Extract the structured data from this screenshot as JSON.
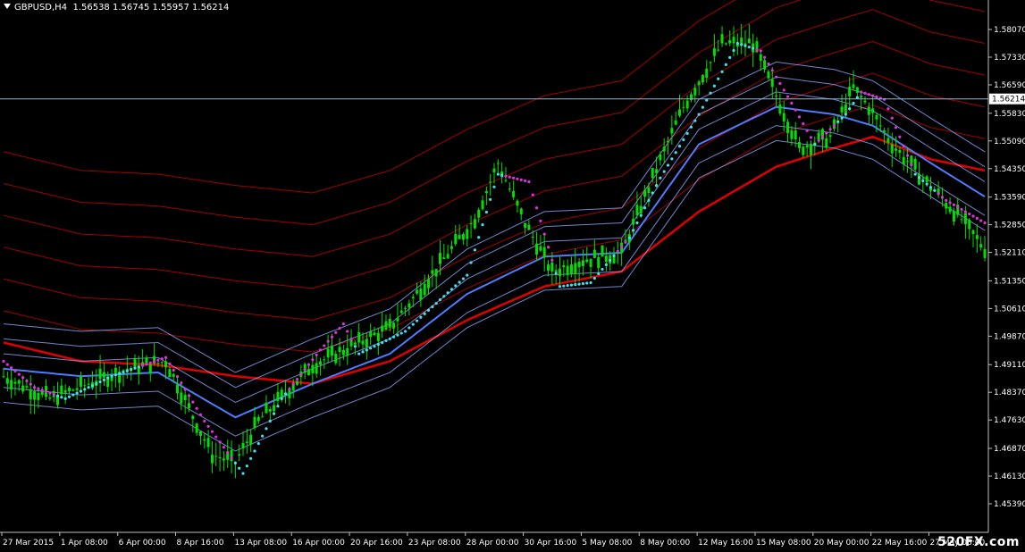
{
  "header": {
    "symbol": "GBPUSD,H4",
    "quote": "1.56538 1.56745 1.55957 1.56214"
  },
  "watermark": "520FX.com",
  "colors": {
    "background": "#000000",
    "axis": "#c0c0c0",
    "bull_candle": "#00e000",
    "fast_ma": "#4f7cff",
    "fast_ribbon": "#8fa6ff",
    "slow_ma": "#e00000",
    "slow_ribbon": "#b30000",
    "trail_up": "#40e0f0",
    "trail_down": "#e030e0",
    "price_line": "#8cb4d2"
  },
  "chart_data": {
    "type": "line",
    "title": "GBPUSD,H4",
    "xlabel": "",
    "ylabel": "",
    "ylim": [
      1.4539,
      1.5807
    ],
    "current_price": "1.56214",
    "yticks": [
      "1.58070",
      "1.57330",
      "1.56590",
      "1.55830",
      "1.55090",
      "1.54350",
      "1.53590",
      "1.52850",
      "1.52110",
      "1.51350",
      "1.50610",
      "1.49870",
      "1.49110",
      "1.48370",
      "1.47630",
      "1.46870",
      "1.46130",
      "1.45390"
    ],
    "ytick_values": [
      1.5807,
      1.5733,
      1.5659,
      1.5583,
      1.5509,
      1.5435,
      1.5359,
      1.5285,
      1.5211,
      1.5135,
      1.5061,
      1.4987,
      1.4911,
      1.4837,
      1.4763,
      1.4687,
      1.4613,
      1.4539
    ],
    "xticks": [
      "27 Mar 2015",
      "1 Apr 08:00",
      "6 Apr 00:00",
      "8 Apr 16:00",
      "13 Apr 08:00",
      "16 Apr 00:00",
      "20 Apr 16:00",
      "23 Apr 08:00",
      "28 Apr 00:00",
      "30 Apr 16:00",
      "5 May 08:00",
      "8 May 00:00",
      "12 May 16:00",
      "15 May 08:00",
      "20 May 00:00",
      "22 May 16:00",
      "27 May 08:00"
    ],
    "xtick_positions": [
      0,
      15,
      30,
      45,
      60,
      75,
      90,
      105,
      120,
      135,
      150,
      165,
      180,
      195,
      210,
      225,
      240
    ],
    "bars": 255,
    "price_path": [
      [
        0,
        1.488
      ],
      [
        12,
        1.482
      ],
      [
        32,
        1.49
      ],
      [
        42,
        1.492
      ],
      [
        54,
        1.467
      ],
      [
        60,
        1.465
      ],
      [
        66,
        1.476
      ],
      [
        80,
        1.491
      ],
      [
        100,
        1.501
      ],
      [
        110,
        1.514
      ],
      [
        122,
        1.53
      ],
      [
        128,
        1.545
      ],
      [
        135,
        1.529
      ],
      [
        142,
        1.516
      ],
      [
        150,
        1.519
      ],
      [
        160,
        1.521
      ],
      [
        168,
        1.541
      ],
      [
        176,
        1.56
      ],
      [
        186,
        1.577
      ],
      [
        194,
        1.577
      ],
      [
        200,
        1.563
      ],
      [
        206,
        1.549
      ],
      [
        214,
        1.552
      ],
      [
        220,
        1.565
      ],
      [
        224,
        1.56
      ],
      [
        230,
        1.55
      ],
      [
        238,
        1.541
      ],
      [
        248,
        1.53
      ],
      [
        254,
        1.522
      ]
    ],
    "series": [
      {
        "name": "",
        "values": [
          [
            0,
            1.49
          ],
          [
            20,
            1.488
          ],
          [
            40,
            1.489
          ],
          [
            60,
            1.477
          ],
          [
            80,
            1.486
          ],
          [
            100,
            1.494
          ],
          [
            120,
            1.51
          ],
          [
            140,
            1.52
          ],
          [
            160,
            1.521
          ],
          [
            180,
            1.55
          ],
          [
            200,
            1.56
          ],
          [
            215,
            1.558
          ],
          [
            225,
            1.555
          ],
          [
            240,
            1.545
          ],
          [
            254,
            1.536
          ]
        ]
      },
      {
        "name": "",
        "values": [
          [
            0,
            1.497
          ],
          [
            20,
            1.492
          ],
          [
            40,
            1.491
          ],
          [
            60,
            1.488
          ],
          [
            80,
            1.486
          ],
          [
            100,
            1.492
          ],
          [
            120,
            1.503
          ],
          [
            140,
            1.512
          ],
          [
            160,
            1.516
          ],
          [
            180,
            1.532
          ],
          [
            200,
            1.544
          ],
          [
            215,
            1.549
          ],
          [
            225,
            1.552
          ],
          [
            240,
            1.546
          ],
          [
            254,
            1.543
          ]
        ]
      }
    ],
    "trailing_stop": [
      [
        0,
        1.492
      ],
      [
        8,
        1.485
      ],
      [
        16,
        1.482
      ],
      [
        28,
        1.488
      ],
      [
        42,
        1.493
      ],
      [
        52,
        1.476
      ],
      [
        62,
        1.462
      ],
      [
        72,
        1.482
      ],
      [
        82,
        1.495
      ],
      [
        88,
        1.502
      ],
      [
        92,
        1.494
      ],
      [
        104,
        1.5
      ],
      [
        120,
        1.515
      ],
      [
        128,
        1.542
      ],
      [
        136,
        1.54
      ],
      [
        144,
        1.512
      ],
      [
        152,
        1.513
      ],
      [
        162,
        1.525
      ],
      [
        170,
        1.541
      ],
      [
        180,
        1.558
      ],
      [
        190,
        1.577
      ],
      [
        196,
        1.575
      ],
      [
        204,
        1.561
      ],
      [
        210,
        1.55
      ],
      [
        218,
        1.558
      ],
      [
        222,
        1.564
      ],
      [
        228,
        1.562
      ],
      [
        236,
        1.542
      ],
      [
        244,
        1.535
      ],
      [
        254,
        1.529
      ]
    ]
  }
}
